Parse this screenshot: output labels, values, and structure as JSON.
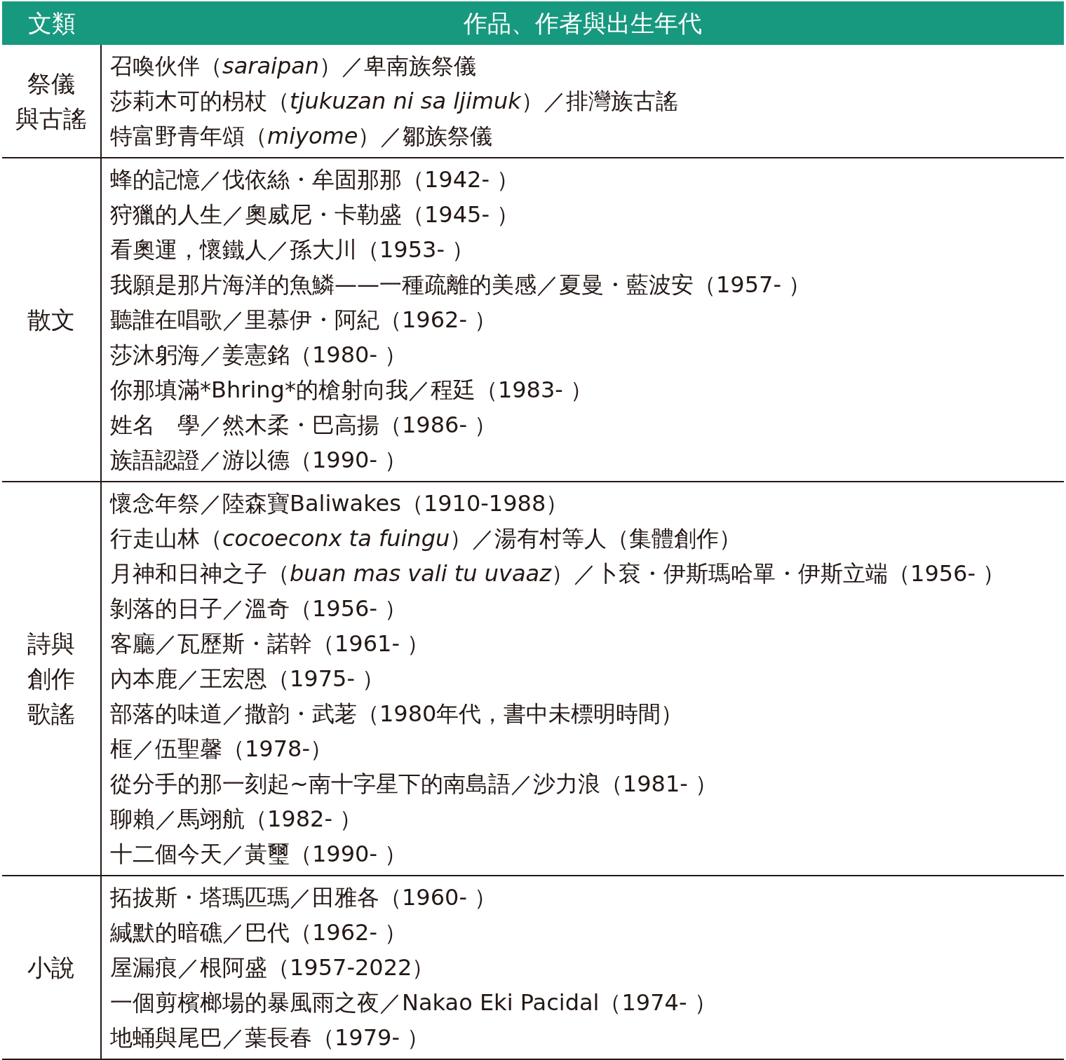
{
  "header": {
    "columns": [
      "文類",
      "作品、作者與出生年代"
    ]
  },
  "sections": [
    {
      "category": [
        "祭儀",
        "與古謠"
      ],
      "entries": [
        "召喚伙伴（*saraipan*）／卑南族祭儀",
        "莎莉木可的枴杖（*tjukuzan ni sa ljimuk*）／排灣族古謠",
        "特富野青年頌（*miyome*）／鄒族祭儀"
      ]
    },
    {
      "category": [
        "散文"
      ],
      "entries": [
        "蜂的記憶／伐依絲・牟固那那（1942- ）",
        "狩獵的人生／奧威尼・卡勒盛（1945- ）",
        "看奧運，懷鐵人／孫大川（1953- ）",
        "我願是那片海洋的魚鱗——一種疏離的美感／夏曼・藍波安（1957- ）",
        "聽誰在唱歌／里慕伊・阿紀（1962- ）",
        "莎沐躬海／姜憲銘（1980- ）",
        "你那填滿*Bhring*的槍射向我／程廷（1983- ）",
        "姓名　學／然木柔・巴高揚（1986- ）",
        "族語認證／游以德（1990- ）"
      ]
    },
    {
      "category": [
        "詩與",
        "創作",
        "歌謠"
      ],
      "entries": [
        "懷念年祭／陸森寶Baliwakes（1910-1988）",
        "行走山林（*cocoeconx ta fuingu*）／湯有村等人（集體創作）",
        "月神和日神之子（*buan mas vali tu uvaaz*）／卜袞・伊斯瑪哈單・伊斯立端（1956- ）",
        "剝落的日子／溫奇（1956- ）",
        "客廳／瓦歷斯・諾幹（1961- ）",
        "內本鹿／王宏恩（1975- ）",
        "部落的味道／撒韵・武荖（1980年代，書中未標明時間）",
        "框／伍聖馨（1978-）",
        "從分手的那一刻起~南十字星下的南島語／沙力浪（1981- ）",
        "聊賴／馬翊航（1982- ）",
        "十二個今天／黃璽（1990- ）"
      ]
    },
    {
      "category": [
        "小說"
      ],
      "entries": [
        "拓拔斯・塔瑪匹瑪／田雅各（1960- ）",
        "緘默的暗礁／巴代（1962- ）",
        "屋漏痕／根阿盛（1957-2022）",
        "一個剪檳榔場的暴風雨之夜／Nakao Eki Pacidal（1974- ）",
        "地蛹與尾巴／葉長春（1979- ）"
      ]
    }
  ]
}
